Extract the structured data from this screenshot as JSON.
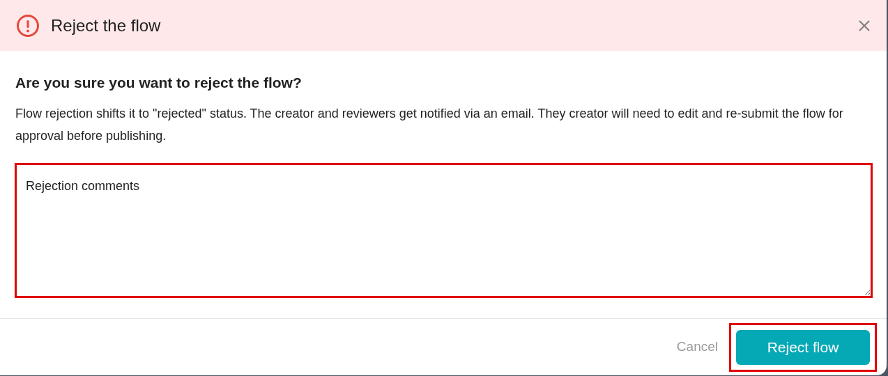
{
  "dialog": {
    "title": "Reject the flow",
    "heading": "Are you sure you want to reject the flow?",
    "description": "Flow rejection shifts it to \"rejected\" status. The creator and reviewers get notified via an email. They creator will need to edit and re-submit the flow for approval before publishing.",
    "comments": {
      "placeholder": "Rejection comments",
      "highlighted": true
    },
    "buttons": [
      {
        "kind": "secondary",
        "label": "Cancel",
        "highlighted": false
      },
      {
        "kind": "primary",
        "label": "Reject flow",
        "highlighted": true
      }
    ]
  }
}
